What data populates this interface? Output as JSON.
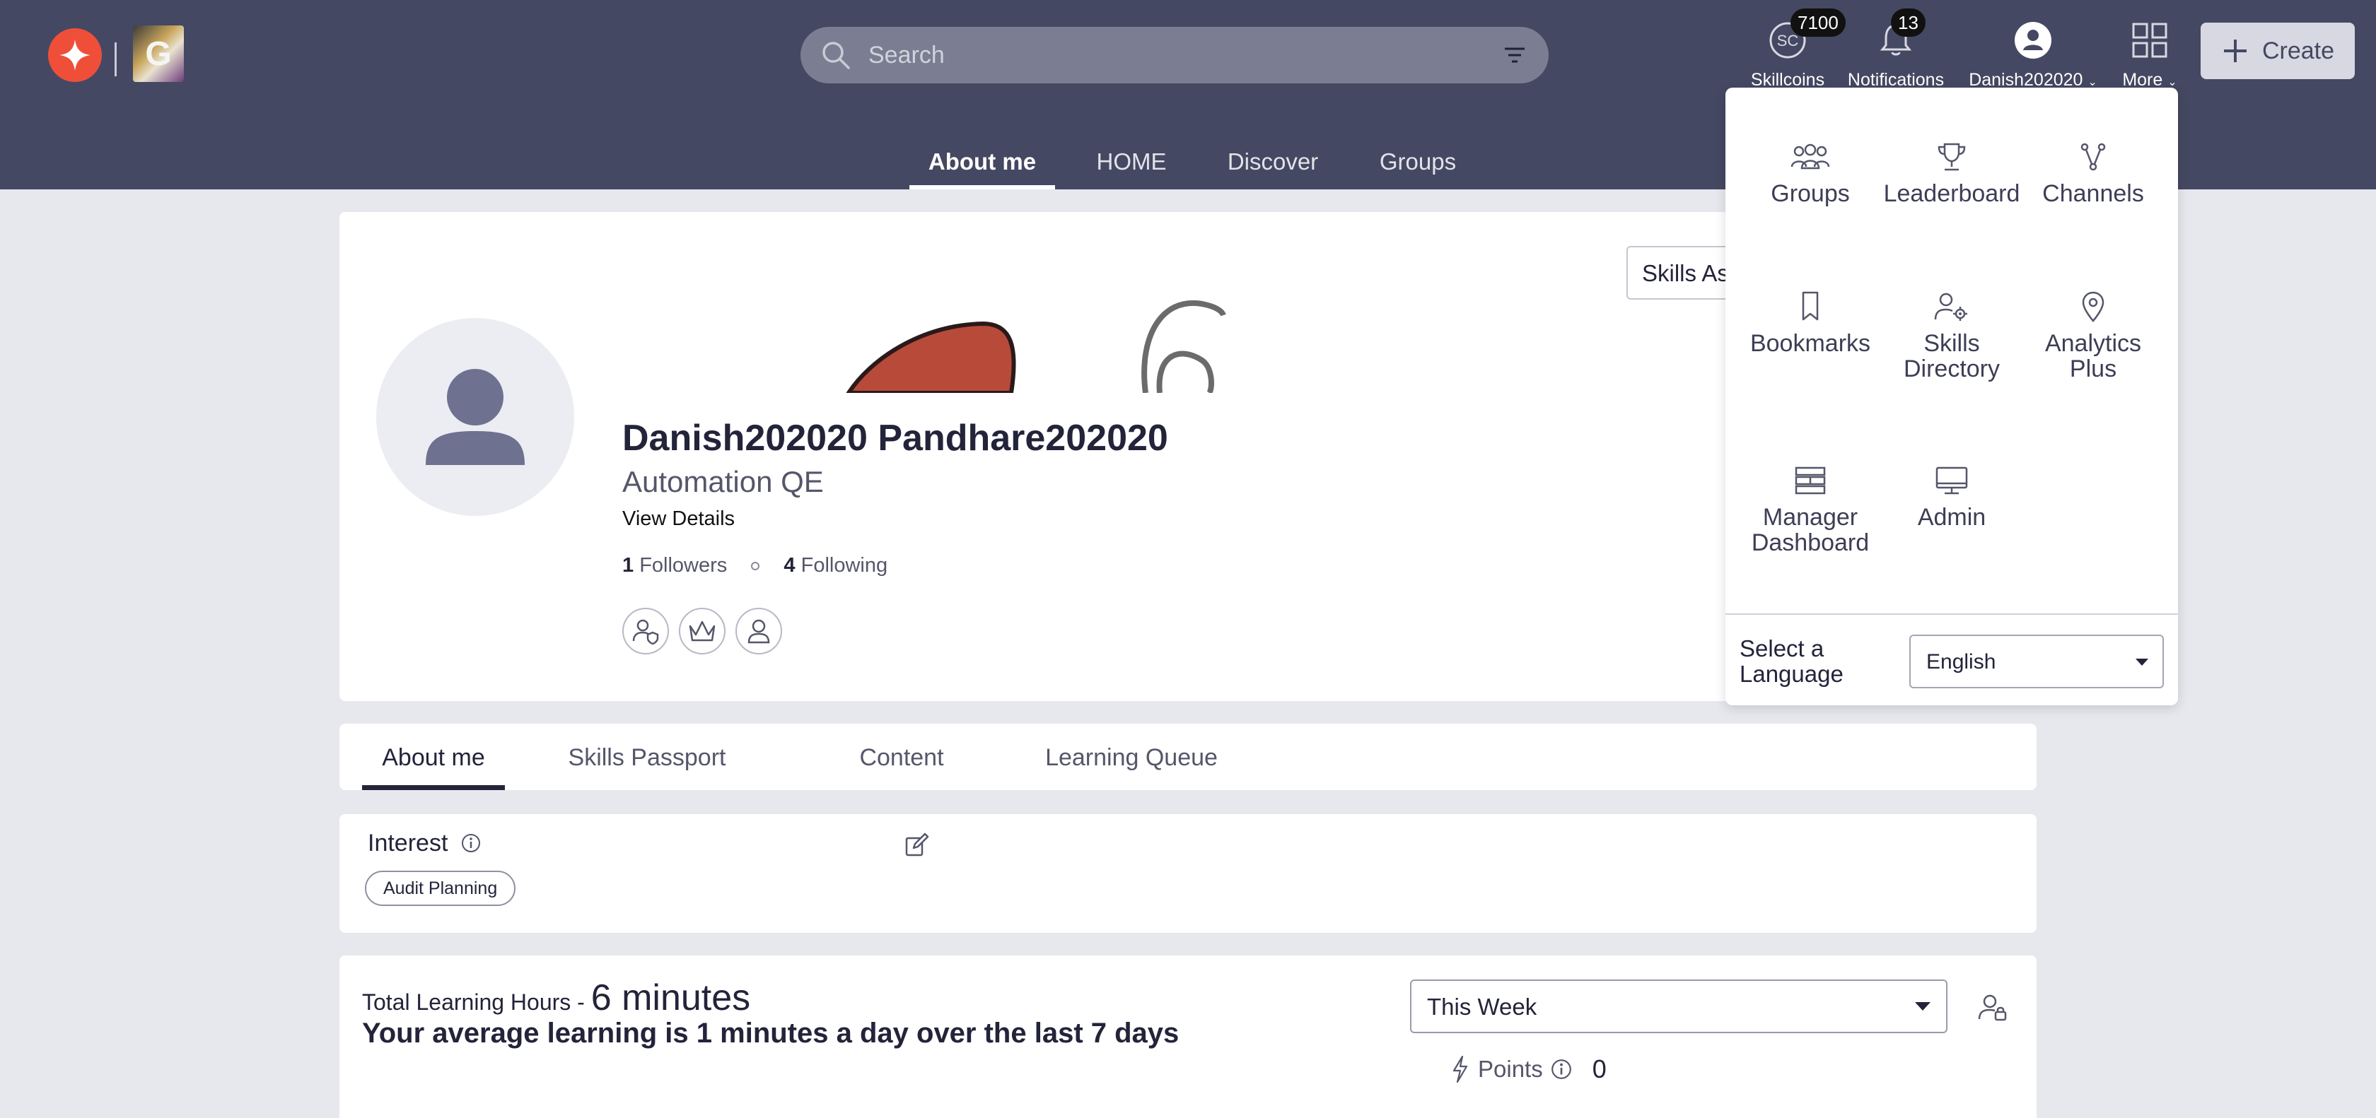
{
  "header": {
    "search_placeholder": "Search",
    "skillcoins": {
      "label": "Skillcoins",
      "icon_text": "SC",
      "count": "7100"
    },
    "notifications": {
      "label": "Notifications",
      "count": "13"
    },
    "user": {
      "label": "Danish202020"
    },
    "more": {
      "label": "More"
    },
    "create_label": "Create",
    "tabs": [
      {
        "label": "About me",
        "active": true
      },
      {
        "label": "HOME"
      },
      {
        "label": "Discover"
      },
      {
        "label": "Groups"
      }
    ]
  },
  "profile": {
    "name": "Danish202020 Pandhare202020",
    "title": "Automation QE",
    "view_details": "View Details",
    "followers_count": "1",
    "followers_label": "Followers",
    "following_count": "4",
    "following_label": "Following",
    "skills_button_label": "Skills As"
  },
  "sub_tabs": [
    {
      "label": "About me",
      "active": true
    },
    {
      "label": "Skills Passport"
    },
    {
      "label": "Content"
    },
    {
      "label": "Learning Queue"
    }
  ],
  "interest": {
    "title": "Interest",
    "chips": [
      "Audit Planning"
    ]
  },
  "learning": {
    "total_label": "Total Learning Hours - ",
    "total_value": "6 minutes",
    "average_text": "Your average learning is 1 minutes a day over the last 7 days",
    "period_select": "This Week",
    "points_label": "Points",
    "points_value": "0"
  },
  "more_menu": {
    "items": [
      {
        "label": "Groups",
        "icon": "groups-icon"
      },
      {
        "label": "Leaderboard",
        "icon": "trophy-icon"
      },
      {
        "label": "Channels",
        "icon": "channels-icon"
      },
      {
        "label": "Bookmarks",
        "icon": "bookmark-icon"
      },
      {
        "label": "Skills Directory",
        "icon": "skills-directory-icon"
      },
      {
        "label": "Analytics Plus",
        "icon": "location-pin-icon"
      },
      {
        "label": "Manager Dashboard",
        "icon": "dashboard-icon"
      },
      {
        "label": "Admin",
        "icon": "monitor-icon"
      }
    ],
    "language_label": "Select a Language",
    "language_value": "English"
  },
  "colors": {
    "header_bg": "#454862",
    "accent_orange": "#ef4f39",
    "page_bg": "#e7e8ee"
  }
}
